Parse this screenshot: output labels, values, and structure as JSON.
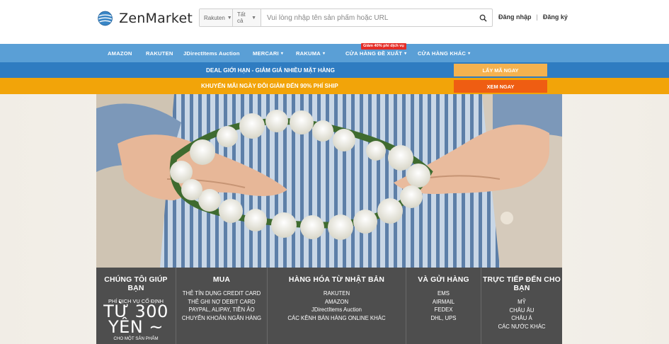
{
  "brand": {
    "name": "ZenMarket"
  },
  "search": {
    "store_select": "Rakuten",
    "category_select": "Tất cả",
    "placeholder": "Vui lòng nhập tên sản phẩm hoặc URL"
  },
  "auth": {
    "login": "Đăng nhập",
    "register": "Đăng ký"
  },
  "nav": {
    "items": [
      {
        "label": "AMAZON"
      },
      {
        "label": "RAKUTEN"
      },
      {
        "label": "JDirectItems Auction"
      },
      {
        "label": "MERCARI"
      },
      {
        "label": "RAKUMA"
      },
      {
        "label": "CỬA HÀNG ĐỀ XUẤT"
      },
      {
        "label": "CỬA HÀNG KHÁC"
      }
    ],
    "promo_badge": "Giảm 40% phí dịch vụ"
  },
  "deals": {
    "bar1_text": "DEAL GIỚI HẠN - GIẢM GIÁ NHIỀU MẶT HÀNG",
    "bar1_button": "LẤY MÃ NGAY",
    "bar2_text": "KHUYẾN MÃI NGÀY ĐÔI GIẢM ĐẾN 90% PHÍ SHIP",
    "bar2_button": "XEM NGAY"
  },
  "colors": {
    "nav": "#5a9fd6",
    "bar1": "#2f7cc1",
    "bar2": "#f2a409",
    "btn_orange": "#f5b24f",
    "btn_red": "#ef5d12",
    "panel": "#4e4e4e"
  },
  "info": {
    "help": {
      "title": "CHÚNG TÔI GIÚP BẠN",
      "line1": "PHÍ DỊCH VỤ CỐ ĐỊNH",
      "price": "TỪ 300",
      "price2": "YÊN ~",
      "note": "CHO MỘT SẢN PHẨM"
    },
    "buy": {
      "title": "MUA",
      "lines": [
        "THẺ TÍN DỤNG CREDIT CARD",
        "THẺ GHI NỢ DEBIT CARD",
        "PAYPAL, ALIPAY, TIỀN ẢO",
        "CHUYỂN KHOẢN NGÂN HÀNG"
      ]
    },
    "goods": {
      "title": "HÀNG HÓA TỪ NHẬT BẢN",
      "lines": [
        "RAKUTEN",
        "AMAZON",
        "JDirectItems Auction",
        "CÁC KÊNH BÁN HÀNG ONLINE KHÁC"
      ]
    },
    "ship": {
      "title": "VÀ GỬI HÀNG",
      "lines": [
        "EMS",
        "AIRMAIL",
        "FEDEX",
        "DHL, UPS"
      ]
    },
    "direct": {
      "title": "TRỰC TIẾP ĐẾN CHO BẠN",
      "lines": [
        "MỸ",
        "CHÂU ÂU",
        "CHÂU Á",
        "CÁC NƯỚC KHÁC"
      ]
    }
  }
}
